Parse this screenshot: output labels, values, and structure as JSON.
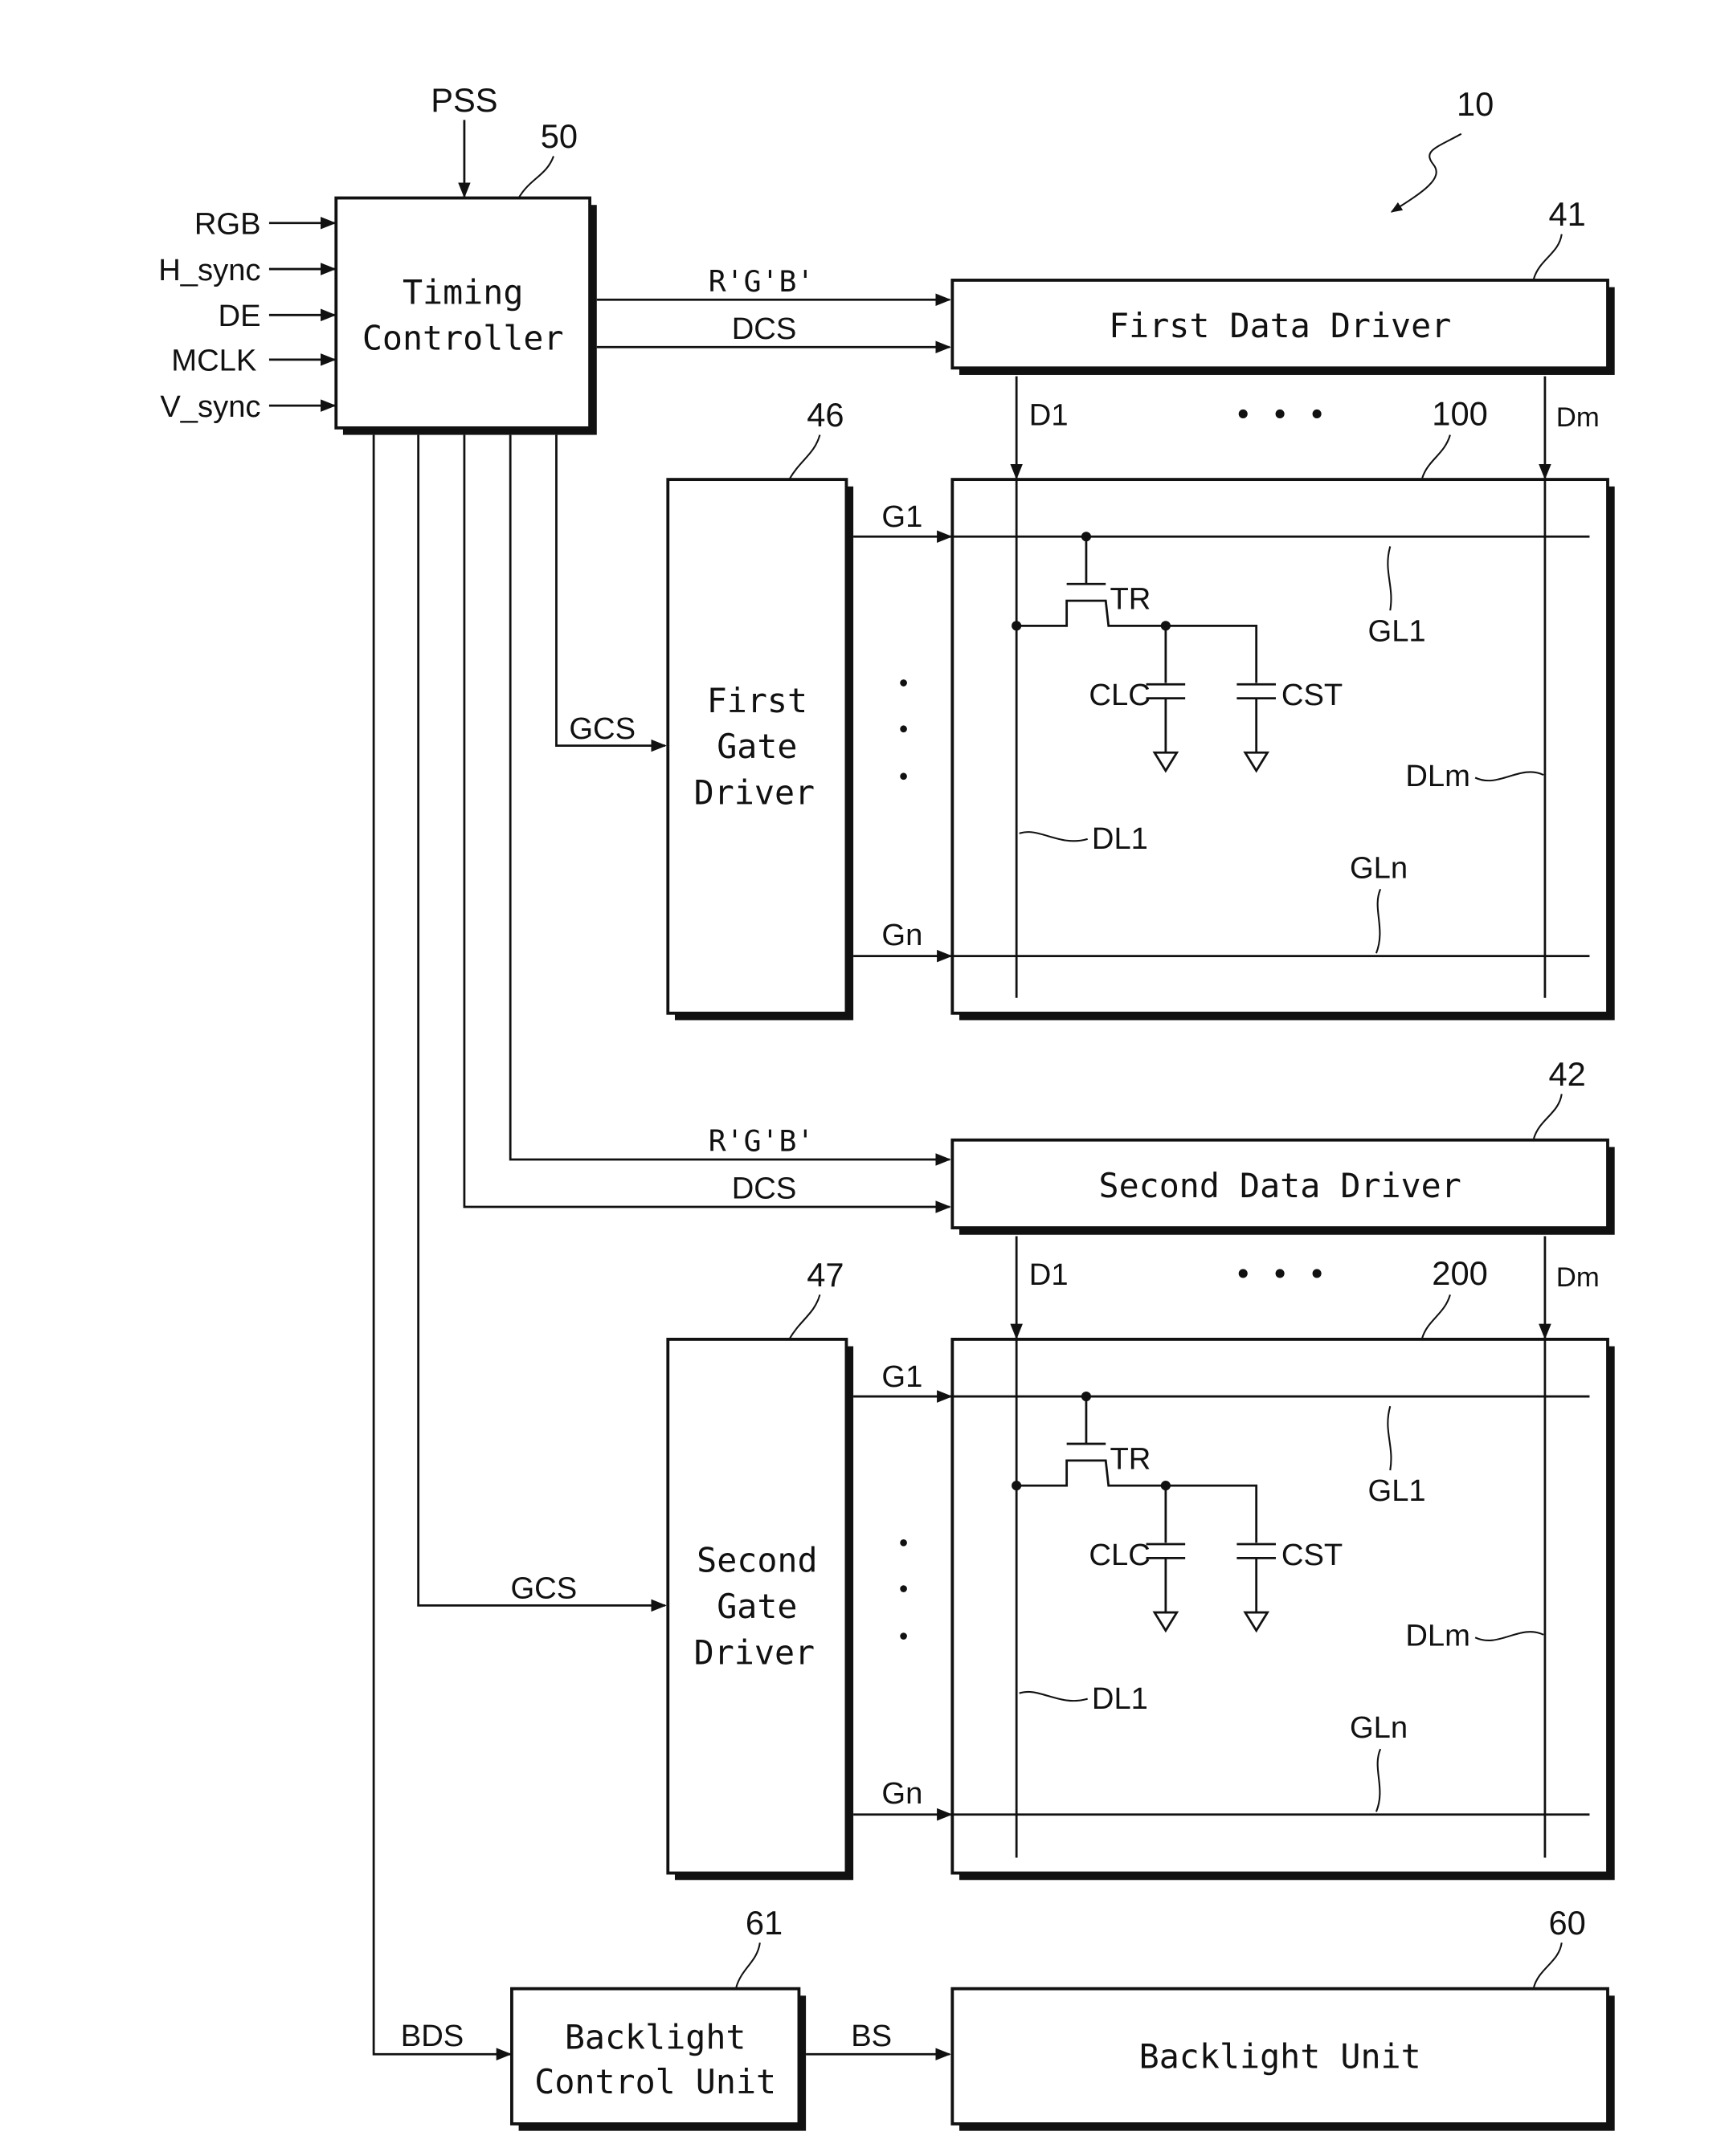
{
  "figure": {
    "ref": "10",
    "timing_controller": {
      "ref": "50",
      "line1": "Timing",
      "line2": "Controller",
      "top_input": "PSS",
      "inputs": [
        "RGB",
        "H_sync",
        "DE",
        "MCLK",
        "V_sync"
      ]
    },
    "first_data_driver": {
      "ref": "41",
      "label": "First Data Driver",
      "in1": "R'G'B'",
      "in2": "DCS"
    },
    "second_data_driver": {
      "ref": "42",
      "label": "Second Data Driver",
      "in1": "R'G'B'",
      "in2": "DCS"
    },
    "first_gate_driver": {
      "ref": "46",
      "line1": "First",
      "line2": "Gate",
      "line3": "Driver",
      "in": "GCS"
    },
    "second_gate_driver": {
      "ref": "47",
      "line1": "Second",
      "line2": "Gate",
      "line3": "Driver",
      "in": "GCS"
    },
    "panel1": {
      "ref": "100",
      "d1": "D1",
      "dm": "Dm",
      "dots": "• • •",
      "g1": "G1",
      "gn": "Gn",
      "tr": "TR",
      "clc": "CLC",
      "cst": "CST",
      "gl1": "GL1",
      "gln": "GLn",
      "dl1": "DL1",
      "dlm": "DLm"
    },
    "panel2": {
      "ref": "200",
      "d1": "D1",
      "dm": "Dm",
      "dots": "• • •",
      "g1": "G1",
      "gn": "Gn",
      "tr": "TR",
      "clc": "CLC",
      "cst": "CST",
      "gl1": "GL1",
      "gln": "GLn",
      "dl1": "DL1",
      "dlm": "DLm"
    },
    "backlight_control": {
      "ref": "61",
      "line1": "Backlight",
      "line2": "Control Unit",
      "in": "BDS",
      "out": "BS"
    },
    "backlight_unit": {
      "ref": "60",
      "label": "Backlight Unit"
    }
  }
}
